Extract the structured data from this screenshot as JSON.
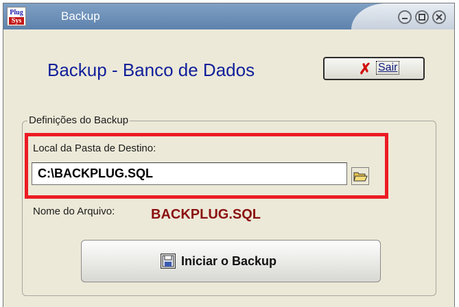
{
  "window": {
    "title": "Backup",
    "app_icon": {
      "line1": "Plug",
      "line2": "Sys"
    },
    "controls": {
      "minimize": "",
      "maximize": "",
      "close": ""
    }
  },
  "header": {
    "title": "Backup - Banco de Dados",
    "exit_button": {
      "icon": "red-x-icon",
      "label": "Sair"
    }
  },
  "settings_group": {
    "legend": "Definições do Backup",
    "destination_label": "Local da Pasta de Destino:",
    "destination_value": "C:\\BACKPLUG.SQL",
    "browse_icon": "open-folder-icon",
    "filename_label": "Nome do Arquivo:",
    "filename_value": "BACKPLUG.SQL"
  },
  "start_button": {
    "icon": "save-disk-icon",
    "label": "Iniciar o Backup"
  },
  "colors": {
    "title_bar": "#5e82ad",
    "header_text": "#11209a",
    "filename_text": "#8b1010",
    "highlight": "#ec1c24",
    "window_bg": "#ece9d8"
  }
}
